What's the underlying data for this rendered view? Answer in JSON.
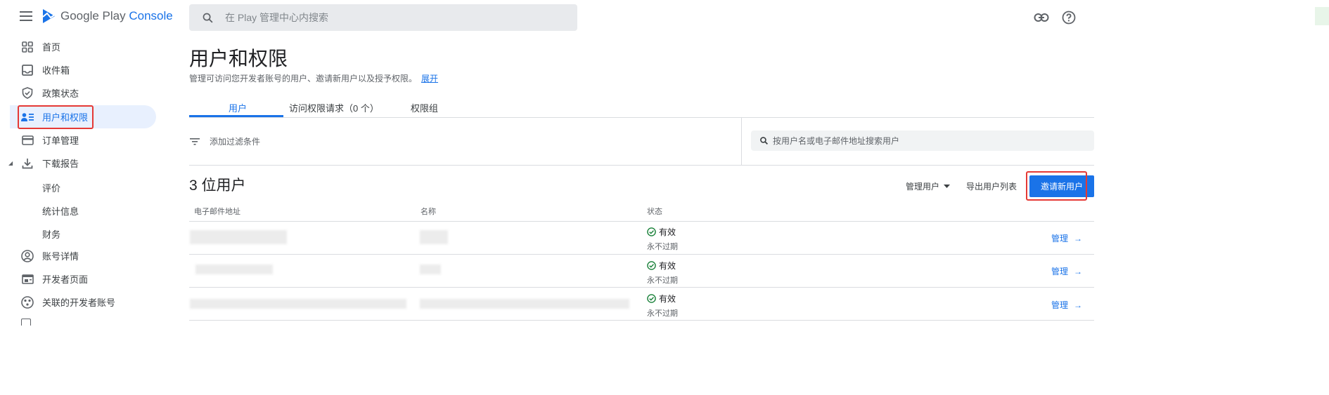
{
  "header": {
    "logo_brand": "Google Play",
    "logo_product": "Console",
    "search_placeholder": "在 Play 管理中心内搜索"
  },
  "sidebar": {
    "items": [
      {
        "label": "首页",
        "icon": "dashboard-icon"
      },
      {
        "label": "收件箱",
        "icon": "inbox-icon"
      },
      {
        "label": "政策状态",
        "icon": "shield-icon"
      },
      {
        "label": "用户和权限",
        "icon": "users-icon",
        "active": true
      },
      {
        "label": "订单管理",
        "icon": "credit-card-icon"
      },
      {
        "label": "下载报告",
        "icon": "download-icon"
      },
      {
        "label": "评价"
      },
      {
        "label": "统计信息"
      },
      {
        "label": "财务"
      },
      {
        "label": "账号详情",
        "icon": "account-circle-icon"
      },
      {
        "label": "开发者页面",
        "icon": "developer-page-icon"
      },
      {
        "label": "关联的开发者账号",
        "icon": "linked-accounts-icon"
      }
    ]
  },
  "page": {
    "title": "用户和权限",
    "description": "管理可访问您开发者账号的用户、邀请新用户以及授予权限。",
    "expand_link": "展开",
    "tabs": [
      "用户",
      "访问权限请求（0 个）",
      "权限组"
    ],
    "filter_label": "添加过滤条件",
    "search_placeholder": "按用户名或电子邮件地址搜索用户",
    "user_count": "3 位用户",
    "manage_users": "管理用户",
    "export_list": "导出用户列表",
    "invite_button": "邀请新用户",
    "columns": [
      "电子邮件地址",
      "名称",
      "状态"
    ],
    "rows": [
      {
        "status": "有效",
        "expiry": "永不过期",
        "action": "管理"
      },
      {
        "status": "有效",
        "expiry": "永不过期",
        "action": "管理"
      },
      {
        "status": "有效",
        "expiry": "永不过期",
        "action": "管理"
      }
    ]
  },
  "colors": {
    "accent": "#1a73e8",
    "highlight_box": "#e53935",
    "active_nav_bg": "#e8f0fe",
    "success": "#188038"
  }
}
